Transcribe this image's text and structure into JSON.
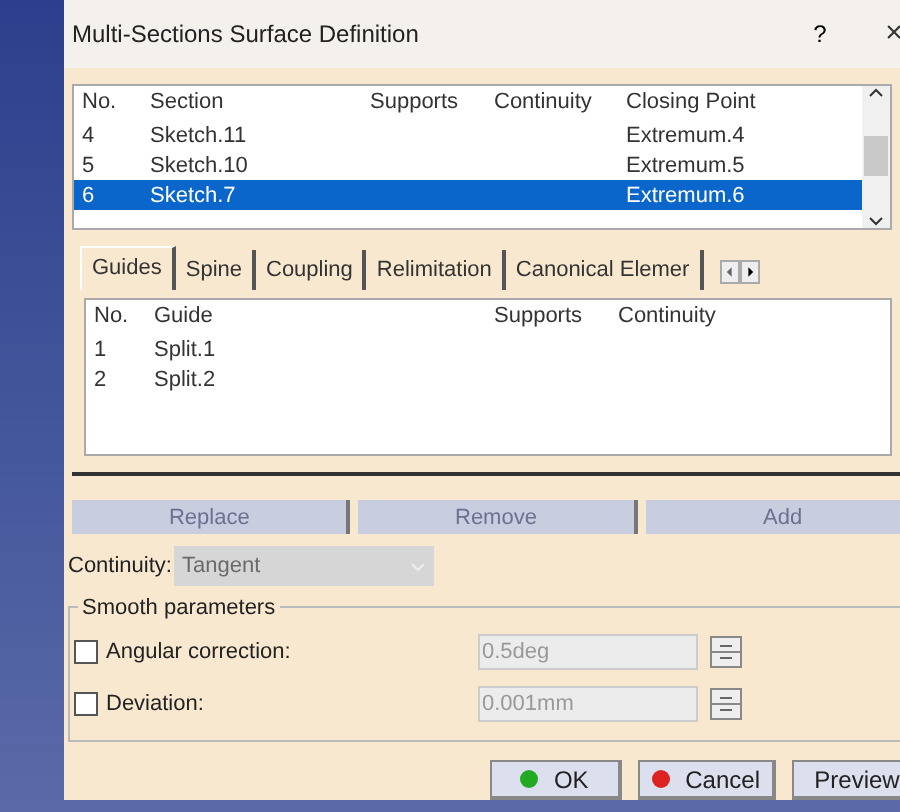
{
  "window": {
    "title": "Multi-Sections Surface Definition",
    "help": "?",
    "close": "×"
  },
  "sections": {
    "columns": [
      "No.",
      "Section",
      "Supports",
      "Continuity",
      "Closing Point"
    ],
    "rows": [
      {
        "cells": [
          "4",
          "Sketch.11",
          "",
          "",
          "Extremum.4"
        ],
        "selected": false
      },
      {
        "cells": [
          "5",
          "Sketch.10",
          "",
          "",
          "Extremum.5"
        ],
        "selected": false
      },
      {
        "cells": [
          "6",
          "Sketch.7",
          "",
          "",
          "Extremum.6"
        ],
        "selected": true
      }
    ]
  },
  "tabs": [
    {
      "label": "Guides",
      "selected": true
    },
    {
      "label": "Spine",
      "selected": false
    },
    {
      "label": "Coupling",
      "selected": false
    },
    {
      "label": "Relimitation",
      "selected": false
    },
    {
      "label": "Canonical Elemer",
      "selected": false
    }
  ],
  "guides": {
    "columns": [
      "No.",
      "Guide",
      "Supports",
      "Continuity"
    ],
    "rows": [
      {
        "cells": [
          "1",
          "Split.1",
          "",
          ""
        ],
        "selected": false
      },
      {
        "cells": [
          "2",
          "Split.2",
          "",
          ""
        ],
        "selected": false
      }
    ]
  },
  "list_buttons": [
    {
      "label": "Replace",
      "disabled": true
    },
    {
      "label": "Remove",
      "disabled": true
    },
    {
      "label": "Add",
      "disabled": true
    }
  ],
  "continuity": {
    "label": "Continuity:",
    "value": "Tangent",
    "disabled": true
  },
  "smooth": {
    "title": "Smooth parameters",
    "params": [
      {
        "label": "Angular correction:",
        "checked": false,
        "value": "0.5deg"
      },
      {
        "label": "Deviation:",
        "checked": false,
        "value": "0.001mm"
      }
    ]
  },
  "buttons": [
    {
      "label": "OK",
      "color": "#22aa22"
    },
    {
      "label": "Cancel",
      "color": "#dd2222"
    },
    {
      "label": "Preview"
    }
  ]
}
